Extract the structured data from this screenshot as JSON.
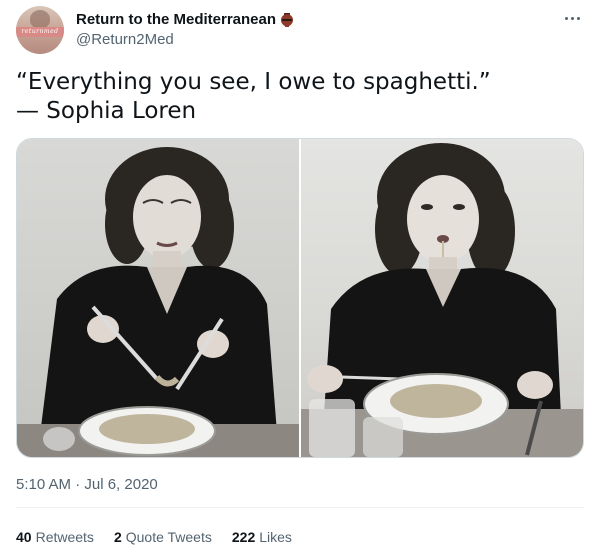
{
  "author": {
    "display_name": "Return to the Mediterranean",
    "handle": "@Return2Med",
    "avatar_text": "returnmed",
    "badge_icon": "amphora-icon"
  },
  "tweet": {
    "line1": "“Everything you see, I owe to spaghetti.”",
    "line2": "— Sophia Loren",
    "timestamp": "5:10 AM · Jul 6, 2020"
  },
  "media": {
    "photos": [
      {
        "name": "photo-woman-twirling-spaghetti"
      },
      {
        "name": "photo-woman-eating-spaghetti"
      }
    ]
  },
  "stats": {
    "retweets_count": "40",
    "retweets_label": "Retweets",
    "quote_count": "2",
    "quote_label": "Quote Tweets",
    "likes_count": "222",
    "likes_label": "Likes"
  },
  "colors": {
    "text_primary": "#0f1419",
    "text_secondary": "#536471",
    "border": "#cfd9de",
    "divider": "#eff3f4"
  }
}
